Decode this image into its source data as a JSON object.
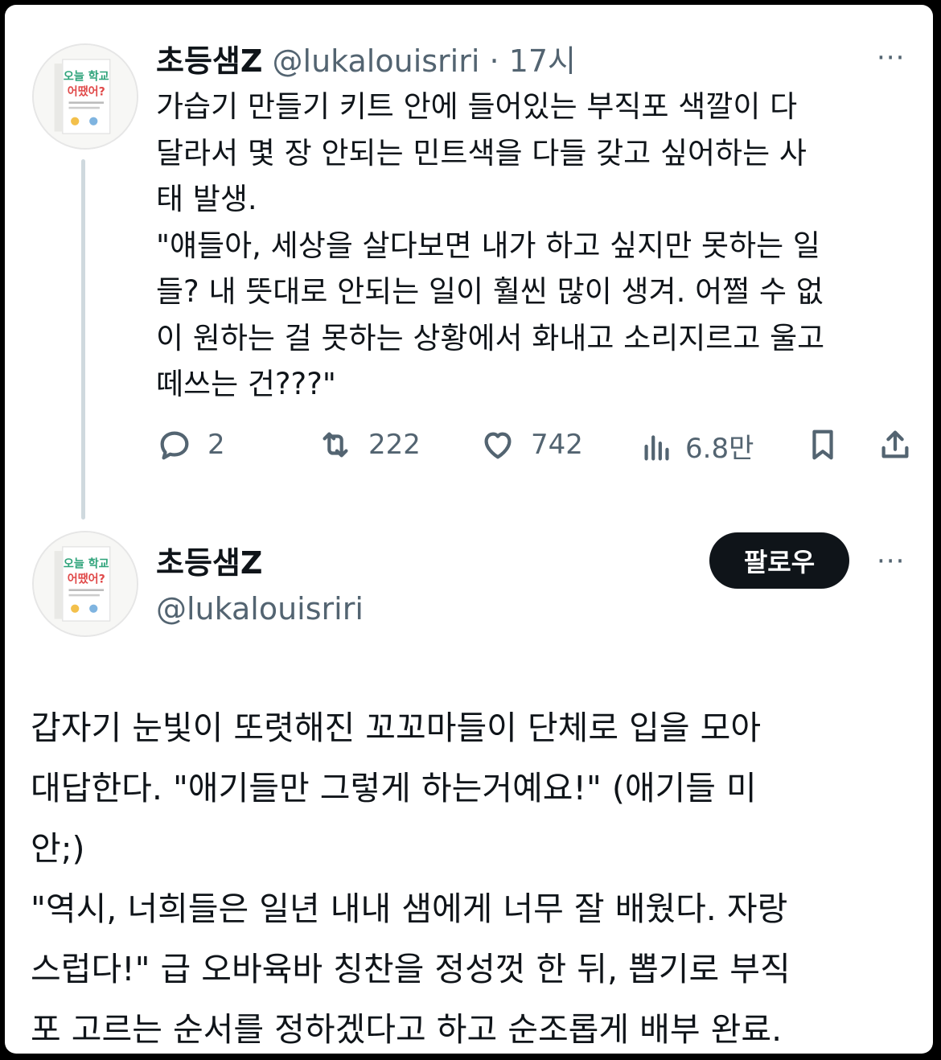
{
  "tweet": {
    "author_name": "초등샘Z",
    "handle": "@lukalouisriri",
    "separator": "·",
    "time": "17시",
    "text_lines": [
      "가습기 만들기 키트 안에 들어있는 부직포 색깔이 다",
      "달라서 몇 장 안되는 민트색을 다들 갖고 싶어하는 사",
      "태 발생.",
      "\"얘들아, 세상을 살다보면 내가 하고 싶지만 못하는 일",
      "들? 내 뜻대로 안되는 일이 훨씬 많이 생겨. 어쩔 수 없",
      "이 원하는 걸 못하는 상황에서 화내고 소리지르고 울고",
      "떼쓰는 건???\""
    ],
    "actions": {
      "reply_count": "2",
      "retweet_count": "222",
      "like_count": "742",
      "view_count": "6.8만"
    }
  },
  "avatar": {
    "book_title_line1": "오늘 학교",
    "book_title_line2": "어땠어?"
  },
  "profile": {
    "author_name": "초등샘Z",
    "handle": "@lukalouisriri",
    "follow_label": "팔로우"
  },
  "more_icon": "···",
  "body": {
    "lines": [
      "갑자기 눈빛이 또렷해진 꼬꼬마들이 단체로 입을 모아",
      "대답한다. \"애기들만 그렇게 하는거예요!\" (애기들 미",
      "안;)",
      "\"역시, 너희들은 일년 내내 샘에게 너무 잘 배웠다. 자랑",
      "스럽다!\" 급 오바육바 칭찬을 정성껏 한 뒤, 뽑기로 부직",
      "포 고르는 순서를 정하겠다고 하고 순조롭게 배부 완료."
    ]
  },
  "colors": {
    "text": "#0f1419",
    "secondary": "#536471",
    "thread_line": "#cfd9de",
    "button_bg": "#0f1419"
  }
}
